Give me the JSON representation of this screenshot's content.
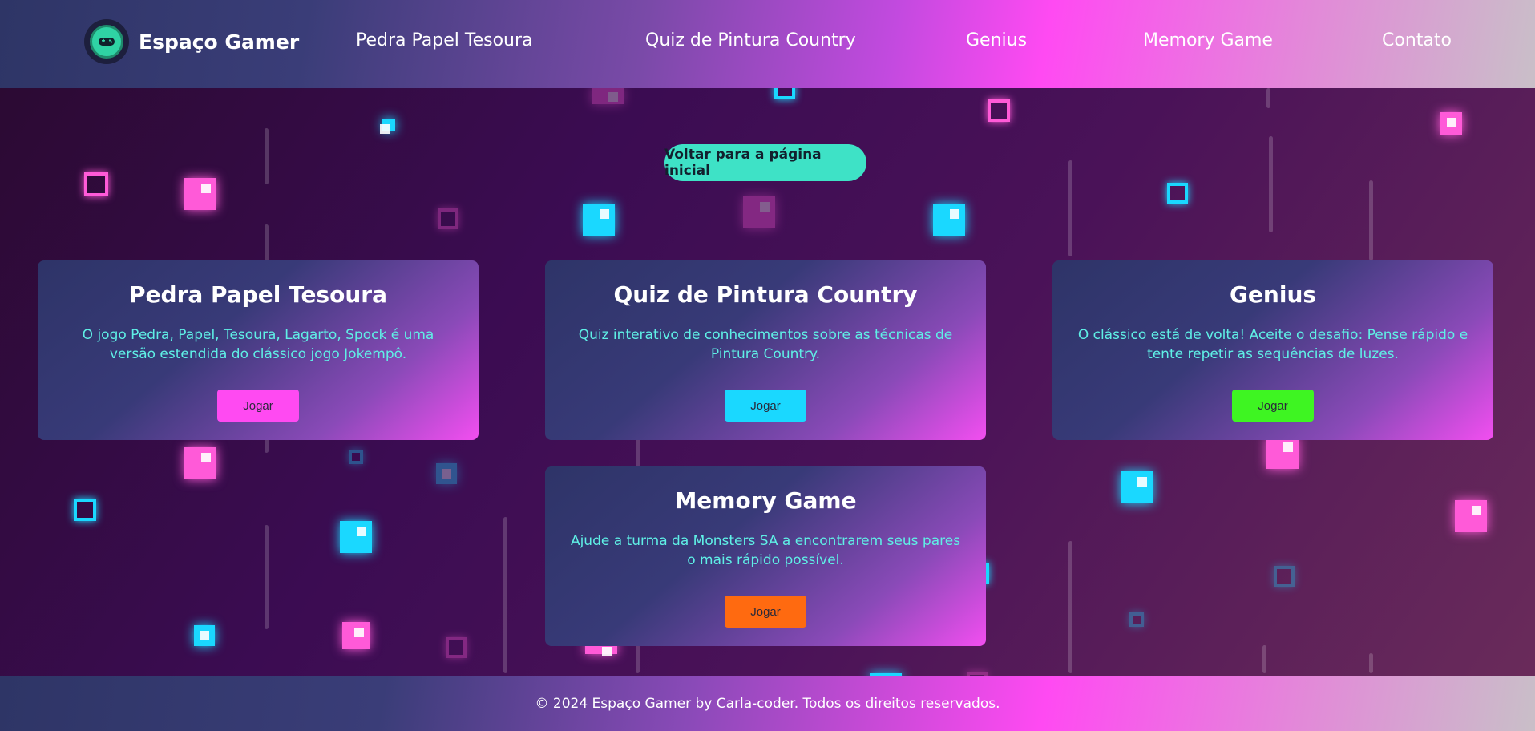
{
  "header": {
    "brand": "Espaço Gamer",
    "logo_icon": "gamepad-icon",
    "nav": [
      {
        "label": "Pedra Papel Tesoura"
      },
      {
        "label": "Quiz de Pintura Country"
      },
      {
        "label": "Genius"
      },
      {
        "label": "Memory Game"
      },
      {
        "label": "Contato"
      }
    ]
  },
  "back_button": "Voltar para a página inicial",
  "cards": [
    {
      "title": "Pedra Papel Tesoura",
      "description": "O jogo Pedra, Papel, Tesoura, Lagarto, Spock é uma versão estendida do clássico jogo Jokempô.",
      "button": "Jogar",
      "button_color": "#ff4af2"
    },
    {
      "title": "Quiz de Pintura Country",
      "description": "Quiz interativo de conhecimentos sobre as técnicas de Pintura Country.",
      "button": "Jogar",
      "button_color": "#1ad8ff"
    },
    {
      "title": "Genius",
      "description": "O clássico está de volta! Aceite o desafio: Pense rápido e tente repetir as sequências de luzes.",
      "button": "Jogar",
      "button_color": "#3ef522"
    },
    {
      "title": "Memory Game",
      "description": "Ajude a turma da Monsters SA a encontrarem seus pares o mais rápido possível.",
      "button": "Jogar",
      "button_color": "#ff6a10"
    }
  ],
  "footer": "© 2024 Espaço Gamer by Carla-coder. Todos os direitos reservados.",
  "colors": {
    "accent_pink": "#ff4af2",
    "accent_cyan": "#1ad8ff",
    "accent_teal": "#3ee2c6",
    "text_cyan": "#5ff0e6"
  }
}
